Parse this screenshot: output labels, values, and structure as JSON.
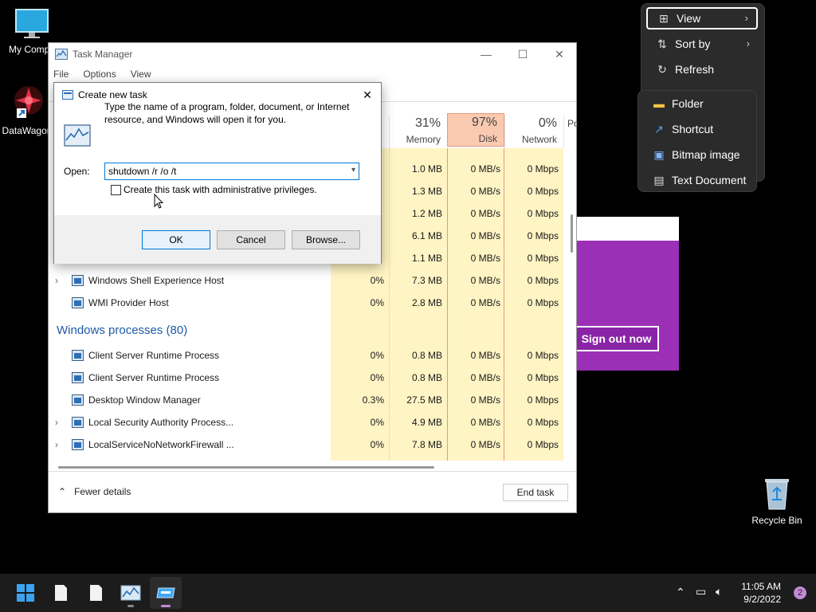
{
  "desktop": {
    "icons": [
      {
        "label": "My Compu"
      },
      {
        "label": "DataWagon"
      },
      {
        "label": "Recycle Bin"
      }
    ]
  },
  "signout": {
    "button_label": "Sign out now",
    "accent": "#9b2fb5"
  },
  "task_manager": {
    "title": "Task Manager",
    "menu": [
      "File",
      "Options",
      "View"
    ],
    "columns": [
      {
        "pct": "31%",
        "name": "Memory"
      },
      {
        "pct": "97%",
        "name": "Disk"
      },
      {
        "pct": "0%",
        "name": "Network"
      },
      {
        "pct": "",
        "name": "Po"
      }
    ],
    "partial_rows": [
      {
        "mem": "1.0 MB",
        "disk": "0 MB/s",
        "net": "0 Mbps"
      },
      {
        "mem": "1.3 MB",
        "disk": "0 MB/s",
        "net": "0 Mbps"
      },
      {
        "mem": "1.2 MB",
        "disk": "0 MB/s",
        "net": "0 Mbps"
      },
      {
        "mem": "6.1 MB",
        "disk": "0 MB/s",
        "net": "0 Mbps"
      },
      {
        "mem": "1.1 MB",
        "disk": "0 MB/s",
        "net": "0 Mbps"
      }
    ],
    "rows_top": [
      {
        "name": "Windows Shell Experience Host",
        "expand": true,
        "cpu": "0%",
        "mem": "7.3 MB",
        "disk": "0 MB/s",
        "net": "0 Mbps"
      },
      {
        "name": "WMI Provider Host",
        "expand": false,
        "cpu": "0%",
        "mem": "2.8 MB",
        "disk": "0 MB/s",
        "net": "0 Mbps"
      }
    ],
    "group_label": "Windows processes (80)",
    "rows_win": [
      {
        "name": "Client Server Runtime Process",
        "expand": false,
        "cpu": "0%",
        "mem": "0.8 MB",
        "disk": "0 MB/s",
        "net": "0 Mbps"
      },
      {
        "name": "Client Server Runtime Process",
        "expand": false,
        "cpu": "0%",
        "mem": "0.8 MB",
        "disk": "0 MB/s",
        "net": "0 Mbps"
      },
      {
        "name": "Desktop Window Manager",
        "expand": false,
        "cpu": "0.3%",
        "mem": "27.5 MB",
        "disk": "0 MB/s",
        "net": "0 Mbps"
      },
      {
        "name": "Local Security Authority Process...",
        "expand": true,
        "cpu": "0%",
        "mem": "4.9 MB",
        "disk": "0 MB/s",
        "net": "0 Mbps"
      },
      {
        "name": "LocalServiceNoNetworkFirewall ...",
        "expand": true,
        "cpu": "0%",
        "mem": "7.8 MB",
        "disk": "0 MB/s",
        "net": "0 Mbps"
      }
    ],
    "fewer_details": "Fewer details",
    "end_task": "End task",
    "colors": {
      "col_tint": "#fff4c4",
      "disk_hot": "#f9c9b0"
    }
  },
  "dialog": {
    "title": "Create new task",
    "description": "Type the name of a program, folder, document, or Internet resource, and Windows will open it for you.",
    "open_label": "Open:",
    "open_value": "shutdown /r /o /t",
    "admin_label": "Create this task with administrative privileges.",
    "ok": "OK",
    "cancel": "Cancel",
    "browse": "Browse..."
  },
  "context_menu": {
    "items": [
      {
        "label": "View",
        "icon": "grid-icon",
        "submenu": true
      },
      {
        "label": "Sort by",
        "icon": "sort-icon",
        "submenu": true
      },
      {
        "label": "Refresh",
        "icon": "refresh-icon",
        "submenu": false
      }
    ],
    "new_submenu": [
      {
        "label": "Folder",
        "icon": "folder-icon"
      },
      {
        "label": "Shortcut",
        "icon": "shortcut-icon"
      },
      {
        "label": "Bitmap image",
        "icon": "bitmap-icon"
      },
      {
        "label": "Text Document",
        "icon": "text-document-icon"
      }
    ]
  },
  "taskbar": {
    "time": "11:05 AM",
    "date": "9/2/2022",
    "notifications": "2"
  }
}
